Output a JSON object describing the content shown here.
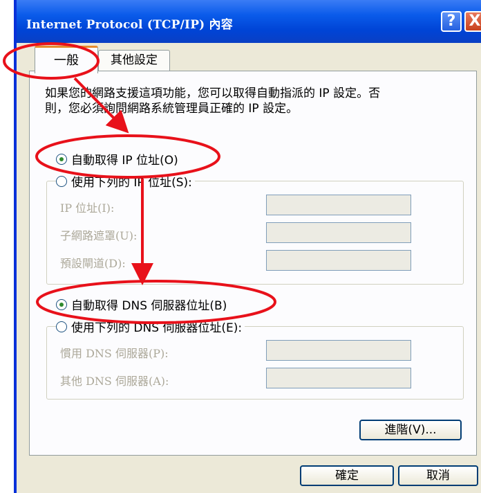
{
  "window": {
    "title": "Internet Protocol (TCP/IP) 內容",
    "help_label": "?",
    "close_label": "X"
  },
  "tabs": [
    {
      "label": "一般",
      "selected": true
    },
    {
      "label": "其他設定",
      "selected": false
    }
  ],
  "description": [
    "如果您的網路支援這項功能，您可以取得自動指派的 IP 設定。否",
    "則，您必須詢問網路系統管理員正確的 IP 設定。"
  ],
  "ip": {
    "auto_label": "自動取得 IP 位址(O)",
    "auto_checked": true,
    "manual_label": "使用下列的 IP 位址(S):",
    "manual_checked": false,
    "fields": [
      {
        "label": "IP 位址(I):",
        "value": ""
      },
      {
        "label": "子網路遮罩(U):",
        "value": ""
      },
      {
        "label": "預設閘道(D):",
        "value": ""
      }
    ]
  },
  "dns": {
    "auto_label": "自動取得 DNS 伺服器位址(B)",
    "auto_checked": true,
    "manual_label": "使用下列的 DNS 伺服器位址(E):",
    "manual_checked": false,
    "fields": [
      {
        "label": "慣用 DNS 伺服器(P):",
        "value": ""
      },
      {
        "label": "其他 DNS 伺服器(A):",
        "value": ""
      }
    ]
  },
  "buttons": {
    "advanced": "進階(V)...",
    "ok": "確定",
    "cancel": "取消"
  },
  "annotation_color": "#e8111a"
}
